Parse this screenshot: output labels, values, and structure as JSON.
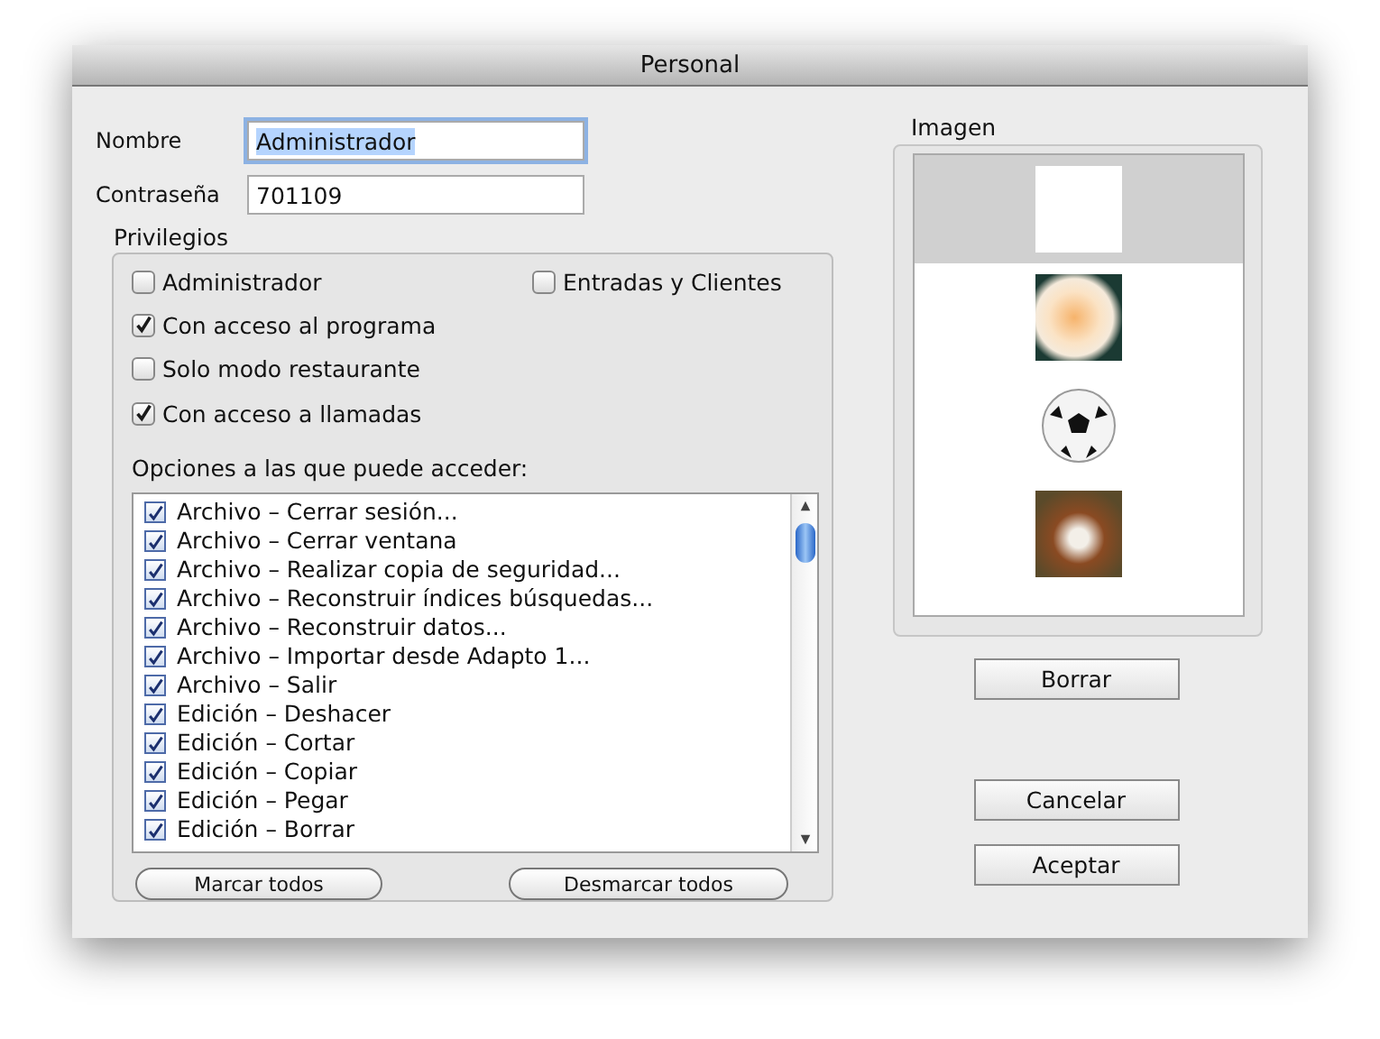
{
  "window": {
    "title": "Personal"
  },
  "fields": [
    {
      "label": "Nombre",
      "value": "Administrador",
      "focused": true
    },
    {
      "label": "Contraseña",
      "value": "701109",
      "focused": false
    }
  ],
  "privileges": {
    "title": "Privilegios",
    "checkboxes": [
      {
        "label": "Administrador",
        "checked": false
      },
      {
        "label": "Entradas y Clientes",
        "checked": false
      },
      {
        "label": "Con acceso al programa",
        "checked": true
      },
      {
        "label": "Solo modo restaurante",
        "checked": false
      },
      {
        "label": "Con acceso a llamadas",
        "checked": true
      }
    ],
    "options_label": "Opciones a las que puede acceder:",
    "options": [
      {
        "label": "Archivo – Cerrar sesión...",
        "checked": true
      },
      {
        "label": "Archivo – Cerrar ventana",
        "checked": true
      },
      {
        "label": "Archivo – Realizar copia de seguridad...",
        "checked": true
      },
      {
        "label": "Archivo – Reconstruir índices búsquedas...",
        "checked": true
      },
      {
        "label": "Archivo – Reconstruir datos...",
        "checked": true
      },
      {
        "label": "Archivo – Importar desde Adapto 1...",
        "checked": true
      },
      {
        "label": "Archivo – Salir",
        "checked": true
      },
      {
        "label": "Edición – Deshacer",
        "checked": true
      },
      {
        "label": "Edición – Cortar",
        "checked": true
      },
      {
        "label": "Edición – Copiar",
        "checked": true
      },
      {
        "label": "Edición – Pegar",
        "checked": true
      },
      {
        "label": "Edición – Borrar",
        "checked": true
      }
    ],
    "buttons": [
      "Marcar todos",
      "Desmarcar todos"
    ]
  },
  "image_panel": {
    "title": "Imagen",
    "images": [
      {
        "kind": "letter",
        "selected": true
      },
      {
        "kind": "flower",
        "selected": false
      },
      {
        "kind": "ball",
        "selected": false
      },
      {
        "kind": "dog",
        "selected": false
      }
    ],
    "delete_button": "Borrar"
  },
  "buttons": [
    "Cancelar",
    "Aceptar"
  ]
}
